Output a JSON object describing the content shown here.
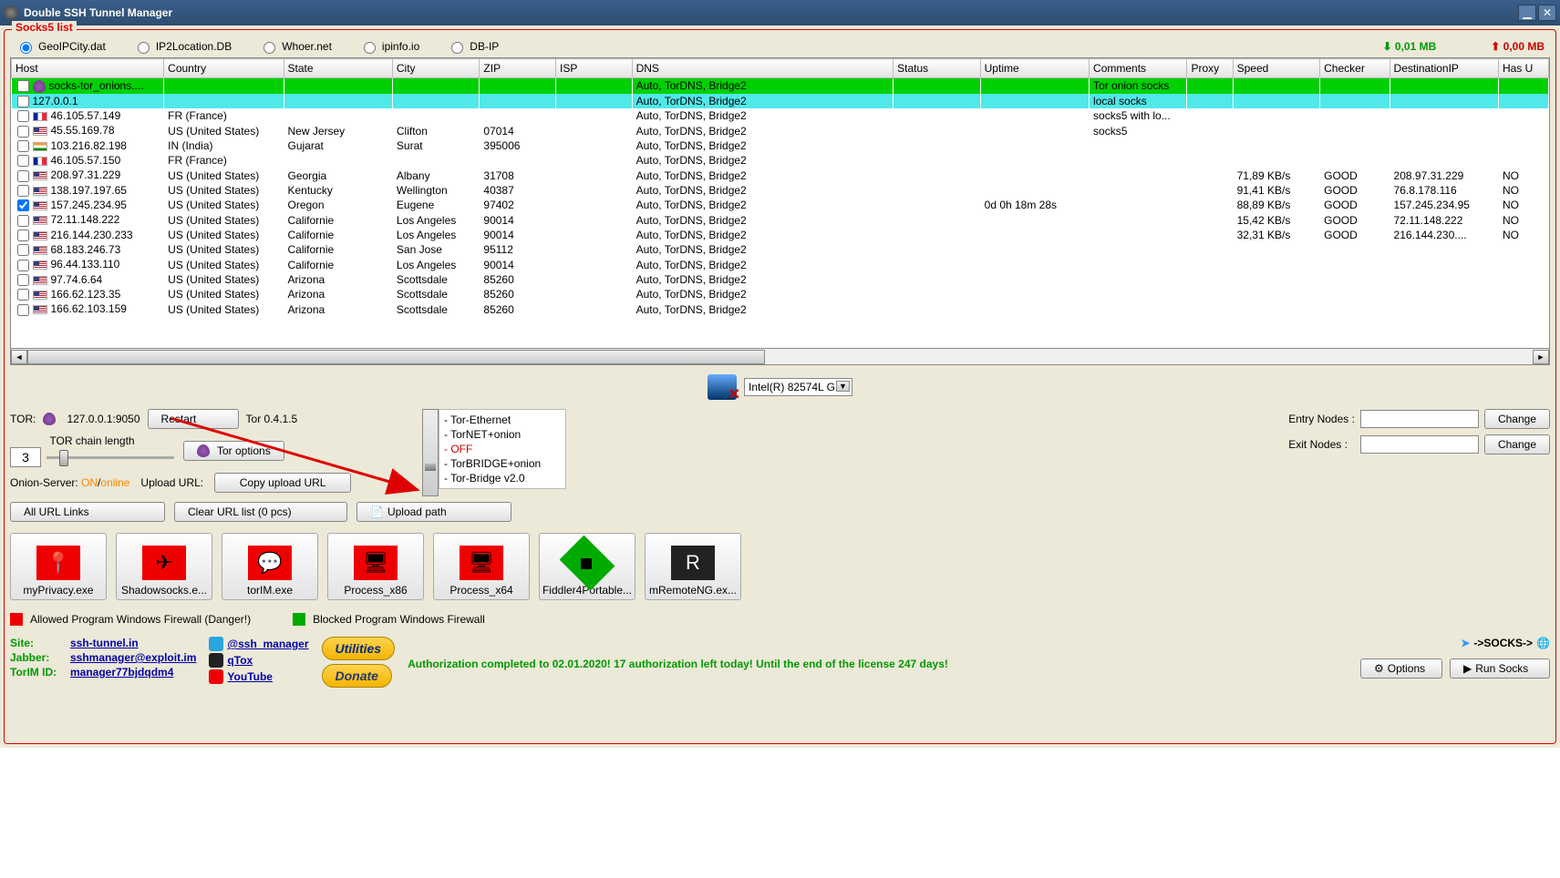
{
  "window": {
    "title": "Double SSH Tunnel Manager"
  },
  "fieldset_legend": "Socks5 list",
  "radios": [
    "GeoIPCity.dat",
    "IP2Location.DB",
    "Whoer.net",
    "ipinfo.io",
    "DB-IP"
  ],
  "transfer": {
    "down": "0,01 MB",
    "up": "0,00 MB"
  },
  "columns": [
    "Host",
    "Country",
    "State",
    "City",
    "ZIP",
    "ISP",
    "DNS",
    "Status",
    "Uptime",
    "Comments",
    "Proxy",
    "Speed",
    "Checker",
    "DestinationIP",
    "Has U"
  ],
  "rows": [
    {
      "cls": "green",
      "chk": false,
      "flag": "onion",
      "host": "socks-tor_onions....",
      "country": "",
      "state": "",
      "city": "",
      "zip": "",
      "isp": "",
      "dns": "Auto, TorDNS, Bridge2",
      "status": "",
      "uptime": "",
      "comments": "Tor onion socks",
      "proxy": "",
      "speed": "",
      "checker": "",
      "dest": "",
      "hasu": ""
    },
    {
      "cls": "cyan",
      "chk": false,
      "flag": "",
      "host": "127.0.0.1",
      "country": "",
      "state": "",
      "city": "",
      "zip": "",
      "isp": "",
      "dns": "Auto, TorDNS, Bridge2",
      "status": "",
      "uptime": "",
      "comments": "local socks",
      "proxy": "",
      "speed": "",
      "checker": "",
      "dest": "",
      "hasu": ""
    },
    {
      "cls": "",
      "chk": false,
      "flag": "fr",
      "host": "46.105.57.149",
      "country": "FR (France)",
      "state": "",
      "city": "",
      "zip": "",
      "isp": "",
      "dns": "Auto, TorDNS, Bridge2",
      "status": "",
      "uptime": "",
      "comments": "socks5 with lo...",
      "proxy": "",
      "speed": "",
      "checker": "",
      "dest": "",
      "hasu": ""
    },
    {
      "cls": "",
      "chk": false,
      "flag": "us",
      "host": "45.55.169.78",
      "country": "US (United States)",
      "state": "New Jersey",
      "city": "Clifton",
      "zip": "07014",
      "isp": "",
      "dns": "Auto, TorDNS, Bridge2",
      "status": "",
      "uptime": "",
      "comments": "socks5",
      "proxy": "",
      "speed": "",
      "checker": "",
      "dest": "",
      "hasu": ""
    },
    {
      "cls": "",
      "chk": false,
      "flag": "in",
      "host": "103.216.82.198",
      "country": "IN (India)",
      "state": "Gujarat",
      "city": "Surat",
      "zip": "395006",
      "isp": "",
      "dns": "Auto, TorDNS, Bridge2",
      "status": "",
      "uptime": "",
      "comments": "",
      "proxy": "",
      "speed": "",
      "checker": "",
      "dest": "",
      "hasu": ""
    },
    {
      "cls": "",
      "chk": false,
      "flag": "fr",
      "host": "46.105.57.150",
      "country": "FR (France)",
      "state": "",
      "city": "",
      "zip": "",
      "isp": "",
      "dns": "Auto, TorDNS, Bridge2",
      "status": "",
      "uptime": "",
      "comments": "",
      "proxy": "",
      "speed": "",
      "checker": "",
      "dest": "",
      "hasu": ""
    },
    {
      "cls": "",
      "chk": false,
      "flag": "us",
      "host": "208.97.31.229",
      "country": "US (United States)",
      "state": "Georgia",
      "city": "Albany",
      "zip": "31708",
      "isp": "",
      "dns": "Auto, TorDNS, Bridge2",
      "status": "",
      "uptime": "",
      "comments": "",
      "proxy": "",
      "speed": "71,89 KB/s",
      "checker": "GOOD",
      "dest": "208.97.31.229",
      "hasu": "NO"
    },
    {
      "cls": "",
      "chk": false,
      "flag": "us",
      "host": "138.197.197.65",
      "country": "US (United States)",
      "state": "Kentucky",
      "city": "Wellington",
      "zip": "40387",
      "isp": "",
      "dns": "Auto, TorDNS, Bridge2",
      "status": "",
      "uptime": "",
      "comments": "",
      "proxy": "",
      "speed": "91,41 KB/s",
      "checker": "GOOD",
      "dest": "76.8.178.116",
      "hasu": "NO"
    },
    {
      "cls": "",
      "chk": true,
      "flag": "us",
      "host": "157.245.234.95",
      "country": "US (United States)",
      "state": "Oregon",
      "city": "Eugene",
      "zip": "97402",
      "isp": "",
      "dns": "Auto, TorDNS, Bridge2",
      "status": "",
      "uptime": "0d 0h 18m 28s",
      "comments": "",
      "proxy": "",
      "speed": "88,89 KB/s",
      "checker": "GOOD",
      "dest": "157.245.234.95",
      "hasu": "NO"
    },
    {
      "cls": "",
      "chk": false,
      "flag": "us",
      "host": "72.11.148.222",
      "country": "US (United States)",
      "state": "Californie",
      "city": "Los Angeles",
      "zip": "90014",
      "isp": "",
      "dns": "Auto, TorDNS, Bridge2",
      "status": "",
      "uptime": "",
      "comments": "",
      "proxy": "",
      "speed": "15,42 KB/s",
      "checker": "GOOD",
      "dest": "72.11.148.222",
      "hasu": "NO"
    },
    {
      "cls": "",
      "chk": false,
      "flag": "us",
      "host": "216.144.230.233",
      "country": "US (United States)",
      "state": "Californie",
      "city": "Los Angeles",
      "zip": "90014",
      "isp": "",
      "dns": "Auto, TorDNS, Bridge2",
      "status": "",
      "uptime": "",
      "comments": "",
      "proxy": "",
      "speed": "32,31 KB/s",
      "checker": "GOOD",
      "dest": "216.144.230....",
      "hasu": "NO"
    },
    {
      "cls": "",
      "chk": false,
      "flag": "us",
      "host": "68.183.246.73",
      "country": "US (United States)",
      "state": "Californie",
      "city": "San Jose",
      "zip": "95112",
      "isp": "",
      "dns": "Auto, TorDNS, Bridge2",
      "status": "",
      "uptime": "",
      "comments": "",
      "proxy": "",
      "speed": "",
      "checker": "",
      "dest": "",
      "hasu": ""
    },
    {
      "cls": "",
      "chk": false,
      "flag": "us",
      "host": "96.44.133.110",
      "country": "US (United States)",
      "state": "Californie",
      "city": "Los Angeles",
      "zip": "90014",
      "isp": "",
      "dns": "Auto, TorDNS, Bridge2",
      "status": "",
      "uptime": "",
      "comments": "",
      "proxy": "",
      "speed": "",
      "checker": "",
      "dest": "",
      "hasu": ""
    },
    {
      "cls": "",
      "chk": false,
      "flag": "us",
      "host": "97.74.6.64",
      "country": "US (United States)",
      "state": "Arizona",
      "city": "Scottsdale",
      "zip": "85260",
      "isp": "",
      "dns": "Auto, TorDNS, Bridge2",
      "status": "",
      "uptime": "",
      "comments": "",
      "proxy": "",
      "speed": "",
      "checker": "",
      "dest": "",
      "hasu": ""
    },
    {
      "cls": "",
      "chk": false,
      "flag": "us",
      "host": "166.62.123.35",
      "country": "US (United States)",
      "state": "Arizona",
      "city": "Scottsdale",
      "zip": "85260",
      "isp": "",
      "dns": "Auto, TorDNS, Bridge2",
      "status": "",
      "uptime": "",
      "comments": "",
      "proxy": "",
      "speed": "",
      "checker": "",
      "dest": "",
      "hasu": ""
    },
    {
      "cls": "",
      "chk": false,
      "flag": "us",
      "host": "166.62.103.159",
      "country": "US (United States)",
      "state": "Arizona",
      "city": "Scottsdale",
      "zip": "85260",
      "isp": "",
      "dns": "Auto, TorDNS, Bridge2",
      "status": "",
      "uptime": "",
      "comments": "",
      "proxy": "",
      "speed": "",
      "checker": "",
      "dest": "",
      "hasu": ""
    }
  ],
  "nic": "Intel(R) 82574L G",
  "tor": {
    "label": "TOR:",
    "addr": "127.0.0.1:9050",
    "restart": "Restart",
    "version": "Tor 0.4.1.5",
    "chain_label": "TOR chain length",
    "chain_value": "3",
    "options": "Tor options"
  },
  "onion_server": {
    "label": "Onion-Server:",
    "on": "ON",
    "sep": "/",
    "online": "online"
  },
  "upload_url": {
    "label": "Upload URL:",
    "copy": "Copy upload URL"
  },
  "modes": [
    "Tor-Ethernet",
    "TorNET+onion",
    "OFF",
    "TorBRIDGE+onion",
    "Tor-Bridge v2.0"
  ],
  "nodes": {
    "entry_label": "Entry Nodes :",
    "exit_label": "Exit Nodes :",
    "change": "Change"
  },
  "actions": {
    "all_url": "All URL Links",
    "clear_url": "Clear URL list (0 pcs)",
    "upload_path": "Upload path"
  },
  "launchers": [
    "myPrivacy.exe",
    "Shadowsocks.e...",
    "torIM.exe",
    "Process_x86",
    "Process_x64",
    "Fiddler4Portable...",
    "mRemoteNG.ex..."
  ],
  "firewall": {
    "allowed": "Allowed Program Windows Firewall (Danger!)",
    "blocked": "Blocked Program Windows Firewall"
  },
  "links": {
    "site_label": "Site:",
    "site": "ssh-tunnel.in",
    "jabber_label": "Jabber:",
    "jabber": "sshmanager@exploit.im",
    "torim_label": "TorIM ID:",
    "torim": "manager77bjdqdm4"
  },
  "social": {
    "telegram": "@ssh_manager",
    "qtox": "qTox",
    "youtube": "YouTube"
  },
  "pills": {
    "util": "Utilities",
    "donate": "Donate"
  },
  "auth_msg": "Authorization completed to 02.01.2020! 17 authorization left today! Until the end of the license 247 days!",
  "socks_indicator": "->SOCKS->",
  "footer_buttons": {
    "options": "Options",
    "run": "Run Socks"
  }
}
